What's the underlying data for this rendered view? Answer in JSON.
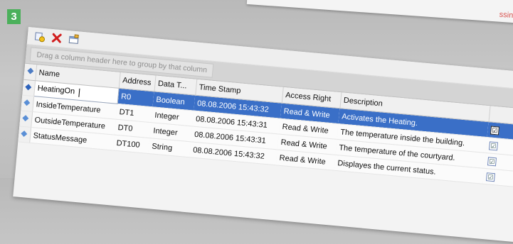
{
  "step_number": "3",
  "top_paper_text": "ssing...",
  "toolbar": {
    "buttons": [
      {
        "icon": "add-icon"
      },
      {
        "icon": "delete-icon"
      },
      {
        "icon": "properties-icon"
      }
    ]
  },
  "group_panel": {
    "hint": "Drag a column header here to group by that column"
  },
  "columns": [
    "Name",
    "Address",
    "Data T...",
    "Time Stamp",
    "Access Right",
    "Description",
    ""
  ],
  "rows": [
    {
      "name": "HeatingOn",
      "address": "R0",
      "data_type": "Boolean",
      "time_stamp": "08.08.2006 15:43:32",
      "access": "Read & Write",
      "description": "Activates the Heating.",
      "checked": "☑"
    },
    {
      "name": "InsideTemperature",
      "address": "DT1",
      "data_type": "Integer",
      "time_stamp": "08.08.2006 15:43:31",
      "access": "Read & Write",
      "description": "The temperature inside the building.",
      "checked": "☑"
    },
    {
      "name": "OutsideTemperature",
      "address": "DT0",
      "data_type": "Integer",
      "time_stamp": "08.08.2006 15:43:31",
      "access": "Read & Write",
      "description": "The temperature of the courtyard.",
      "checked": "☑"
    },
    {
      "name": "StatusMessage",
      "address": "DT100",
      "data_type": "String",
      "time_stamp": "08.08.2006 15:43:32",
      "access": "Read & Write",
      "description": "Displayes the current status.",
      "checked": "☑"
    }
  ],
  "colors": {
    "selection": "#3a6fc7",
    "step_badge": "#4bb05b"
  }
}
